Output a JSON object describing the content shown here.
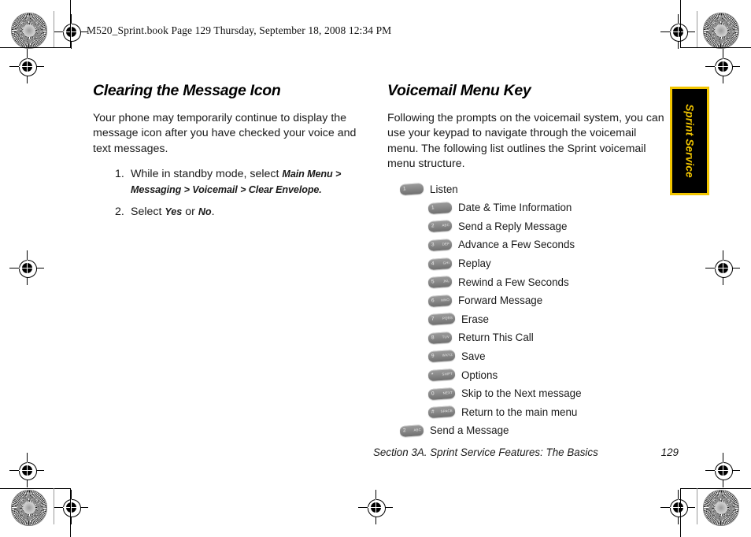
{
  "running_head": "M520_Sprint.book  Page 129  Thursday, September 18, 2008  12:34 PM",
  "left_column": {
    "heading": "Clearing the Message Icon",
    "paragraph": "Your phone may temporarily continue to display the message icon after you have checked your voice and text messages.",
    "steps": [
      {
        "lead": "While in standby mode, select ",
        "path": "Main Menu > Messaging > Voicemail > Clear Envelope.",
        "tail": ""
      },
      {
        "lead": "Select ",
        "emph1": "Yes",
        "mid": " or ",
        "emph2": "No",
        "tail": "."
      }
    ]
  },
  "right_column": {
    "heading": "Voicemail Menu Key",
    "paragraph": "Following the prompts on the voicemail system, you can use your keypad to navigate through the voicemail menu. The following list outlines the Sprint voicemail menu structure.",
    "menu_items": [
      {
        "level": 1,
        "icon": "key-1-icon",
        "digit": "1",
        "letters": "",
        "label": "Listen"
      },
      {
        "level": 2,
        "icon": "key-1-icon",
        "digit": "1",
        "letters": "",
        "label": "Date & Time Information"
      },
      {
        "level": 2,
        "icon": "key-2-icon",
        "digit": "2",
        "letters": "ABC",
        "label": "Send a Reply Message"
      },
      {
        "level": 2,
        "icon": "key-3-icon",
        "digit": "3",
        "letters": "DEF",
        "label": "Advance a Few Seconds"
      },
      {
        "level": 2,
        "icon": "key-4-icon",
        "digit": "4",
        "letters": "GHI",
        "label": "Replay"
      },
      {
        "level": 2,
        "icon": "key-5-icon",
        "digit": "5",
        "letters": "JKL",
        "label": "Rewind a Few Seconds"
      },
      {
        "level": 2,
        "icon": "key-6-icon",
        "digit": "6",
        "letters": "MNO",
        "label": "Forward Message"
      },
      {
        "level": 2,
        "icon": "key-7-icon",
        "digit": "7",
        "letters": "PQRS",
        "label": "Erase"
      },
      {
        "level": 2,
        "icon": "key-8-icon",
        "digit": "8",
        "letters": "TUV",
        "label": "Return This Call"
      },
      {
        "level": 2,
        "icon": "key-9-icon",
        "digit": "9",
        "letters": "WXYZ",
        "label": "Save"
      },
      {
        "level": 2,
        "icon": "key-star-icon",
        "digit": "*",
        "letters": "SHIFT",
        "label": "Options"
      },
      {
        "level": 2,
        "icon": "key-0-icon",
        "digit": "0",
        "letters": "NEXT",
        "label": "Skip to the Next message"
      },
      {
        "level": 2,
        "icon": "key-hash-icon",
        "digit": "#",
        "letters": "SPACE",
        "label": "Return to the main menu"
      },
      {
        "level": 1,
        "icon": "key-2-icon",
        "digit": "2",
        "letters": "ABC",
        "label": "Send a Message"
      }
    ]
  },
  "side_tab": {
    "label": "Sprint Service",
    "background": "#000000",
    "border_color": "#f2c500",
    "text_color": "#f2c500"
  },
  "footer": {
    "section": "Section 3A. Sprint Service Features: The Basics",
    "page_number": "129"
  }
}
